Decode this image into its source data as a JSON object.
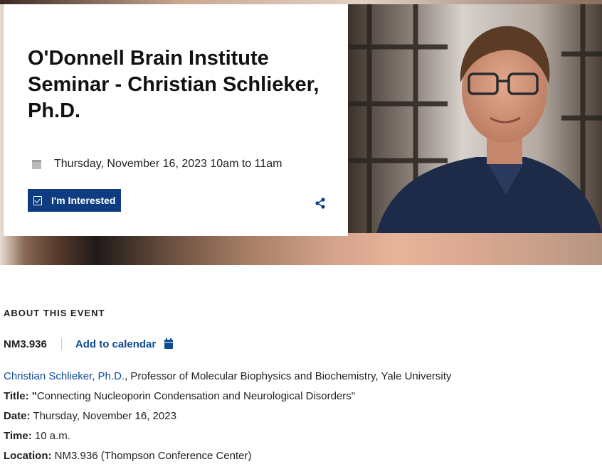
{
  "event": {
    "title": "O'Donnell Brain Institute Seminar - Christian Schlieker, Ph.D.",
    "datetime": "Thursday, November 16, 2023 10am to 11am",
    "interested_label": "I'm Interested"
  },
  "about": {
    "heading": "ABOUT THIS EVENT",
    "room": "NM3.936",
    "add_calendar_label": "Add to calendar"
  },
  "details": {
    "speaker_link": "Christian Schlieker, Ph.D.",
    "speaker_affiliation": ", Professor of Molecular Biophysics and Biochemistry, Yale University",
    "title_label": "Title: \"",
    "title_value": "Connecting Nucleoporin Condensation and Neurological Disorders\"",
    "date_label": "Date:",
    "date_value": " Thursday, November 16, 2023",
    "time_label": "Time:",
    "time_value": " 10 a.m.",
    "location_label": "Location:",
    "location_value": " NM3.936 (Thompson Conference Center)"
  },
  "colors": {
    "accent": "#0d3d80",
    "link": "#0d4a94",
    "text": "#222222"
  },
  "icons": [
    "calendar-icon",
    "checkbox-calendar-icon",
    "share-icon",
    "add-calendar-icon"
  ]
}
